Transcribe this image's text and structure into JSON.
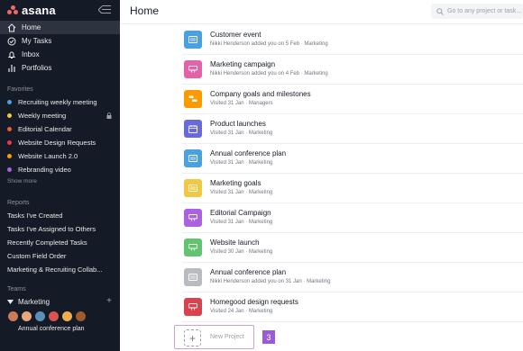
{
  "sidebar": {
    "logo": "asana",
    "nav": [
      {
        "label": "Home",
        "icon": "home-icon"
      },
      {
        "label": "My Tasks",
        "icon": "check-circle-icon"
      },
      {
        "label": "Inbox",
        "icon": "bell-icon"
      },
      {
        "label": "Portfolios",
        "icon": "bar-chart-icon"
      }
    ],
    "favorites_label": "Favorites",
    "favorites": [
      {
        "label": "Recruiting weekly meeting",
        "color": "#4ba0e0"
      },
      {
        "label": "Weekly meeting",
        "color": "#f3c742"
      },
      {
        "label": "Editorial Calendar",
        "color": "#e85e3c"
      },
      {
        "label": "Website Design Requests",
        "color": "#e8384f"
      },
      {
        "label": "Website Launch 2.0",
        "color": "#fd9a00"
      },
      {
        "label": "Rebranding video",
        "color": "#aa62e3"
      }
    ],
    "show_more": "Show more",
    "reports_label": "Reports",
    "reports": [
      "Tasks I've Created",
      "Tasks I've Assigned to Others",
      "Recently Completed Tasks",
      "Custom Field Order",
      "Marketing & Recruiting Collab..."
    ],
    "teams_label": "Teams",
    "team_name": "Marketing",
    "team_avatars": [
      "#c97b5a",
      "#e8a87c",
      "#5b8fb9",
      "#d9534f",
      "#f0ad4e",
      "#a05a2c"
    ],
    "team_project": "Annual conference plan"
  },
  "header": {
    "title": "Home",
    "search_placeholder": "Go to any project or task..."
  },
  "projects": [
    {
      "name": "Customer event",
      "meta": "Nikki Henderson added you on 5 Feb · Marketing",
      "color": "#4ba0e0",
      "icon": "list-icon"
    },
    {
      "name": "Marketing campaign",
      "meta": "Nikki Henderson added you on 4 Feb · Marketing",
      "color": "#e362a8",
      "icon": "board-icon"
    },
    {
      "name": "Company goals and milestones",
      "meta": "Visited 31 Jan · Managers",
      "color": "#fd9a00",
      "icon": "timeline-icon"
    },
    {
      "name": "Product launches",
      "meta": "Visited 31 Jan · Marketing",
      "color": "#6b6ad9",
      "icon": "calendar-icon"
    },
    {
      "name": "Annual conference plan",
      "meta": "Visited 31 Jan · Marketing",
      "color": "#4ba0e0",
      "icon": "list-icon"
    },
    {
      "name": "Marketing goals",
      "meta": "Visited 31 Jan · Marketing",
      "color": "#f3c742",
      "icon": "list-icon"
    },
    {
      "name": "Editorial Campaign",
      "meta": "Visited 31 Jan · Marketing",
      "color": "#aa62e3",
      "icon": "board-icon"
    },
    {
      "name": "Website launch",
      "meta": "Visited 30 Jan · Marketing",
      "color": "#62c370",
      "icon": "board-icon"
    },
    {
      "name": "Annual conference plan",
      "meta": "Nikki Henderson added you on 31 Jan · Marketing",
      "color": "#b8bcc2",
      "icon": "list-icon"
    },
    {
      "name": "Homegood design requests",
      "meta": "Visited 24 Jan · Marketing",
      "color": "#d9434f",
      "icon": "board-icon"
    }
  ],
  "new_project_label": "New Project",
  "step_badge": "3"
}
